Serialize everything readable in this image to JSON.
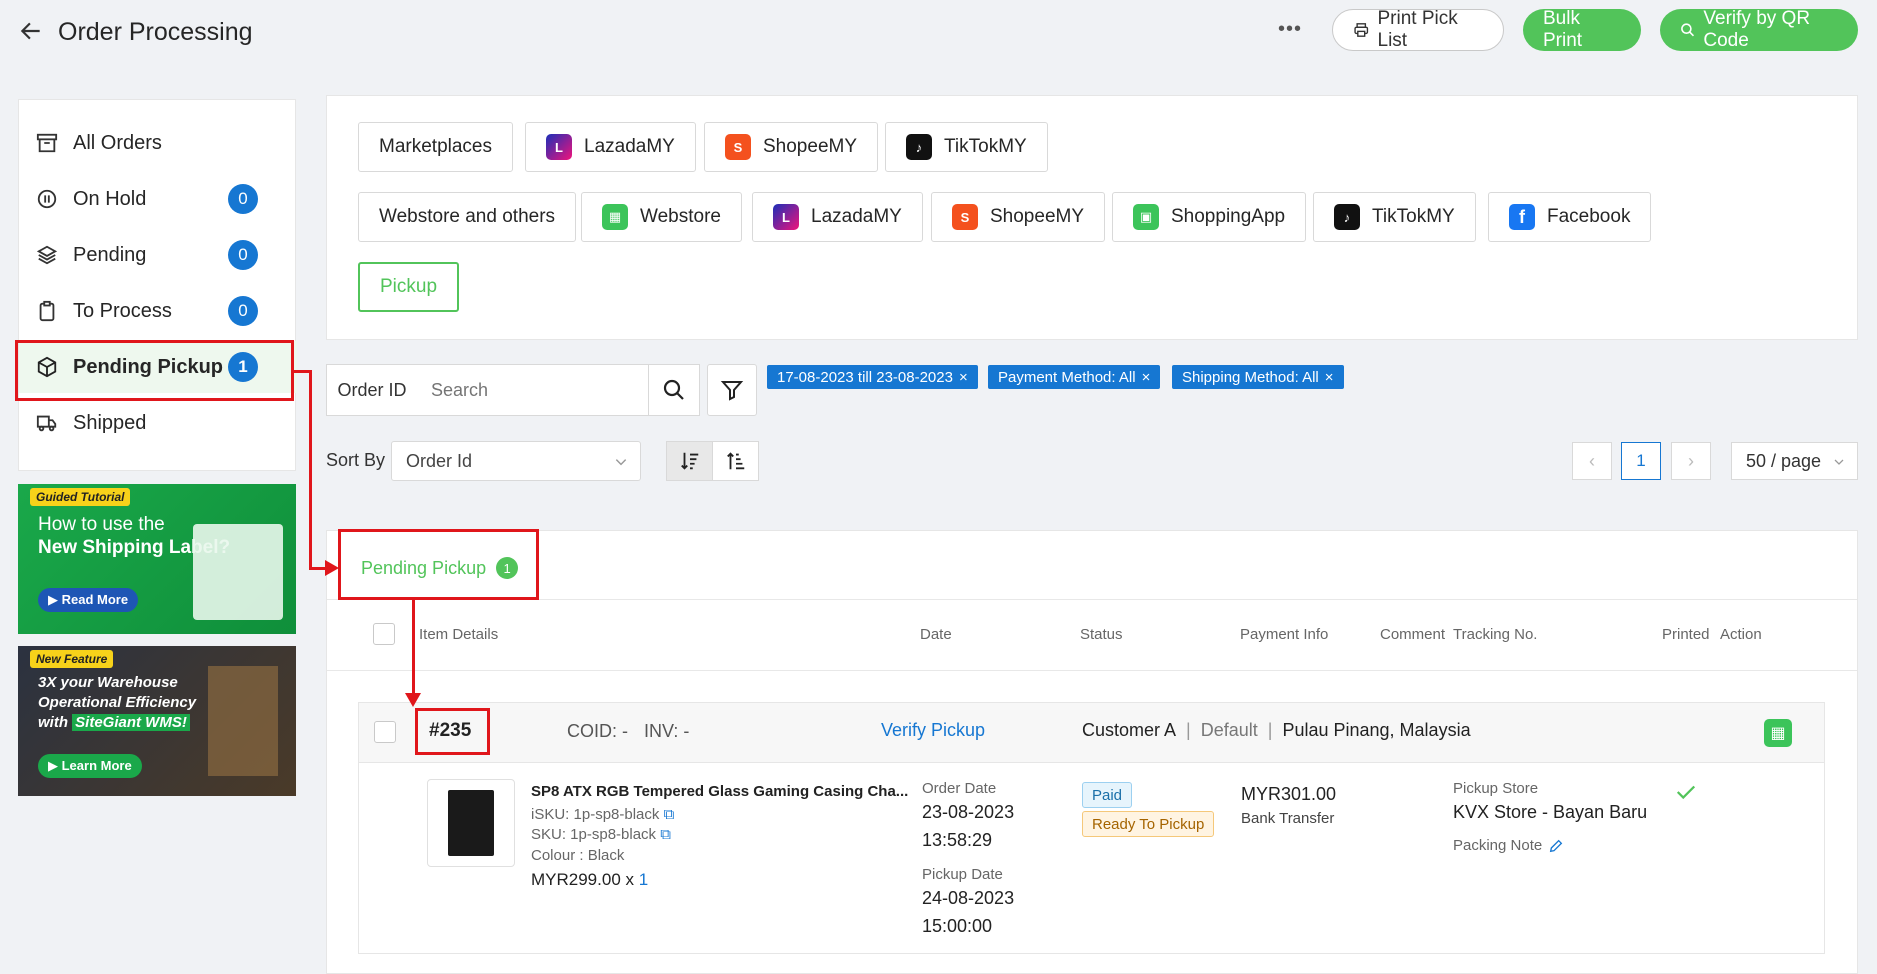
{
  "header": {
    "title": "Order Processing",
    "print_pick_list": "Print Pick List",
    "bulk_print": "Bulk Print",
    "verify_qr": "Verify by QR Code"
  },
  "sidebar": {
    "items": [
      {
        "label": "All Orders",
        "badge": ""
      },
      {
        "label": "On Hold",
        "badge": "0"
      },
      {
        "label": "Pending",
        "badge": "0"
      },
      {
        "label": "To Process",
        "badge": "0"
      },
      {
        "label": "Pending Pickup",
        "badge": "1"
      },
      {
        "label": "Shipped",
        "badge": ""
      }
    ]
  },
  "promos": {
    "tutorial": {
      "tag": "Guided Tutorial",
      "line1": "How to use the",
      "line2": "New Shipping Label?",
      "cta": "Read More"
    },
    "feature": {
      "tag": "New Feature",
      "line1": "3X your Warehouse",
      "line2": "Operational Efficiency",
      "line3a": "with",
      "line3b": "SiteGiant WMS!",
      "cta": "Learn More"
    }
  },
  "channels": {
    "row1": [
      "Marketplaces",
      "LazadaMY",
      "ShopeeMY",
      "TikTokMY"
    ],
    "row2": [
      "Webstore and others",
      "Webstore",
      "LazadaMY",
      "ShopeeMY",
      "ShoppingApp",
      "TikTokMY",
      "Facebook"
    ],
    "row3": [
      "Pickup"
    ]
  },
  "search": {
    "field_label": "Order ID",
    "placeholder": "Search",
    "filters": [
      "17-08-2023 till 23-08-2023",
      "Payment Method: All",
      "Shipping Method: All"
    ]
  },
  "sort": {
    "label": "Sort By",
    "value": "Order Id",
    "page": "1",
    "per_page": "50 / page"
  },
  "tab": {
    "label": "Pending Pickup",
    "count": "1"
  },
  "table": {
    "headers": [
      "Item Details",
      "Date",
      "Status",
      "Payment Info",
      "Comment",
      "Tracking No.",
      "Printed",
      "Action"
    ]
  },
  "order": {
    "id": "#235",
    "coid": "COID: -",
    "inv": "INV: -",
    "verify": "Verify Pickup",
    "customer": "Customer A",
    "default": "Default",
    "location": "Pulau Pinang, Malaysia",
    "item_name": "SP8 ATX RGB Tempered Glass Gaming Casing Cha...",
    "isku": "iSKU: 1p-sp8-black",
    "sku": "SKU: 1p-sp8-black",
    "colour": "Colour : Black",
    "price": "MYR299.00 x",
    "qty": "1",
    "order_date_label": "Order Date",
    "order_date": "23-08-2023",
    "order_time": "13:58:29",
    "pickup_date_label": "Pickup Date",
    "pickup_date": "24-08-2023",
    "pickup_time": "15:00:00",
    "status_paid": "Paid",
    "status_ready": "Ready To Pickup",
    "amount": "MYR301.00",
    "payment_method": "Bank Transfer",
    "pickup_store_label": "Pickup Store",
    "pickup_store": "KVX Store - Bayan Baru",
    "packing_note": "Packing Note"
  }
}
